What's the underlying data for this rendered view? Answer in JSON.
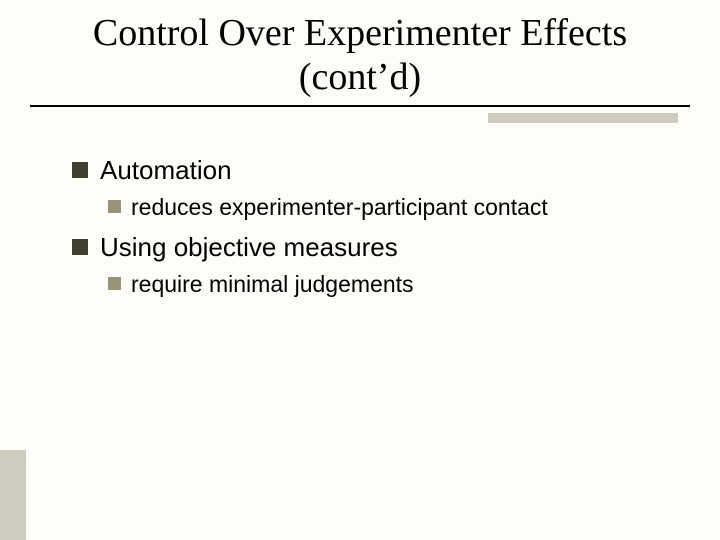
{
  "title": {
    "line1": "Control Over  Experimenter Effects",
    "line2": "(cont’d)"
  },
  "bullets": [
    {
      "text": "Automation",
      "children": [
        {
          "text": "reduces experimenter-participant contact"
        }
      ]
    },
    {
      "text": "Using objective measures",
      "children": [
        {
          "text": "require minimal judgements"
        }
      ]
    }
  ],
  "colors": {
    "bullet_l1": "#44402f",
    "bullet_l2": "#9a937a",
    "accent": "#d0cbbf"
  }
}
